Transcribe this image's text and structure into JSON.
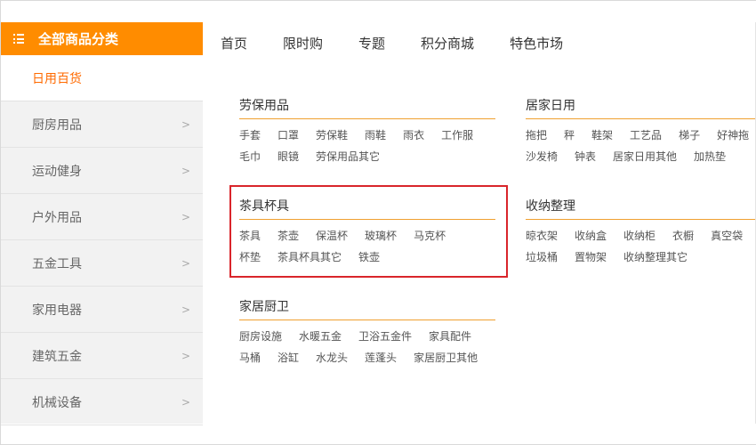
{
  "sidebar": {
    "header": "全部商品分类",
    "items": [
      {
        "label": "日用百货",
        "active": true
      },
      {
        "label": "厨房用品"
      },
      {
        "label": "运动健身"
      },
      {
        "label": "户外用品"
      },
      {
        "label": "五金工具"
      },
      {
        "label": "家用电器"
      },
      {
        "label": "建筑五金"
      },
      {
        "label": "机械设备"
      }
    ]
  },
  "nav": [
    "首页",
    "限时购",
    "专题",
    "积分商城",
    "特色市场"
  ],
  "groups": {
    "laobao": {
      "title": "劳保用品",
      "items": [
        "手套",
        "口罩",
        "劳保鞋",
        "雨鞋",
        "雨衣",
        "工作服",
        "毛巾",
        "眼镜",
        "劳保用品其它"
      ]
    },
    "jujia": {
      "title": "居家日用",
      "items": [
        "拖把",
        "秤",
        "鞋架",
        "工艺品",
        "梯子",
        "好神拖",
        "沙发椅",
        "钟表",
        "居家日用其他",
        "加热垫"
      ]
    },
    "chaju": {
      "title": "茶具杯具",
      "items": [
        "茶具",
        "茶壶",
        "保温杯",
        "玻璃杯",
        "马克杯",
        "杯垫",
        "茶具杯具其它",
        "铁壶"
      ]
    },
    "shouna": {
      "title": "收纳整理",
      "items": [
        "晾衣架",
        "收纳盒",
        "收纳柜",
        "衣橱",
        "真空袋",
        "垃圾桶",
        "置物架",
        "收纳整理其它"
      ]
    },
    "chuwei": {
      "title": "家居厨卫",
      "items": [
        "厨房设施",
        "水暖五金",
        "卫浴五金件",
        "家具配件",
        "马桶",
        "浴缸",
        "水龙头",
        "莲蓬头",
        "家居厨卫其他"
      ]
    }
  }
}
